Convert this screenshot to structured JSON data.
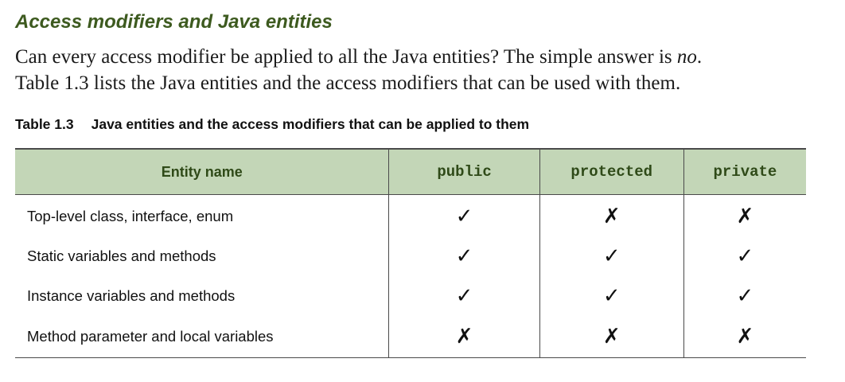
{
  "section": {
    "heading": "Access modifiers and Java entities",
    "para_line1_pre": "Can every access modifier be applied to all the Java entities? The simple answer is ",
    "para_line1_emph": "no",
    "para_line1_post": ".",
    "para_line2": "Table 1.3 lists the Java entities and the access modifiers that can be used with them."
  },
  "table": {
    "caption_number": "Table 1.3",
    "caption_text": "Java entities and the access modifiers that can be applied to them",
    "headers": [
      "Entity name",
      "public",
      "protected",
      "private"
    ],
    "rows": [
      {
        "name": "Top-level class, interface, enum",
        "public": "✓",
        "protected": "✗",
        "private": "✗"
      },
      {
        "name": "Static variables and methods",
        "public": "✓",
        "protected": "✓",
        "private": "✓"
      },
      {
        "name": "Instance variables and methods",
        "public": "✓",
        "protected": "✓",
        "private": "✓"
      },
      {
        "name": "Method parameter and local variables",
        "public": "✗",
        "protected": "✗",
        "private": "✗"
      }
    ]
  }
}
